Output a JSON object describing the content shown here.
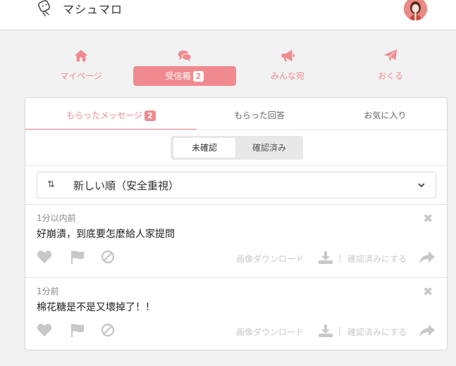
{
  "header": {
    "app_name": "マシュマロ",
    "logo_icon": "marshmallow-logo-icon",
    "avatar_icon": "user-avatar"
  },
  "nav": [
    {
      "label": "マイページ",
      "icon": "home-icon",
      "active": false
    },
    {
      "label": "受信箱",
      "badge": "2",
      "icon": "comments-icon",
      "active": true
    },
    {
      "label": "みんな宛",
      "icon": "megaphone-icon",
      "active": false
    },
    {
      "label": "おくる",
      "icon": "paper-plane-icon",
      "active": false
    }
  ],
  "tabs": [
    {
      "label": "もらったメッセージ",
      "badge": "2",
      "active": true
    },
    {
      "label": "もらった回答",
      "active": false
    },
    {
      "label": "お気に入り",
      "active": false
    }
  ],
  "filter": {
    "unconfirmed": "未確認",
    "confirmed": "確認済み",
    "selected": "未確認"
  },
  "sort": {
    "label": "新しい順（安全重視）",
    "icon": "sort-arrows-icon"
  },
  "messages": [
    {
      "time": "1分以内前",
      "text": "好崩潰，到底要怎麼給人家提問",
      "download_label": "画像ダウンロード",
      "separator": "|",
      "confirm_label": "確認済みにする"
    },
    {
      "time": "1分前",
      "text": "棉花糖是不是又壞掉了！！",
      "download_label": "画像ダウンロード",
      "separator": "|",
      "confirm_label": "確認済みにする"
    }
  ],
  "colors": {
    "accent": "#f08a8f",
    "muted_icon": "#c8c8c8",
    "background": "#f2f2f3"
  }
}
